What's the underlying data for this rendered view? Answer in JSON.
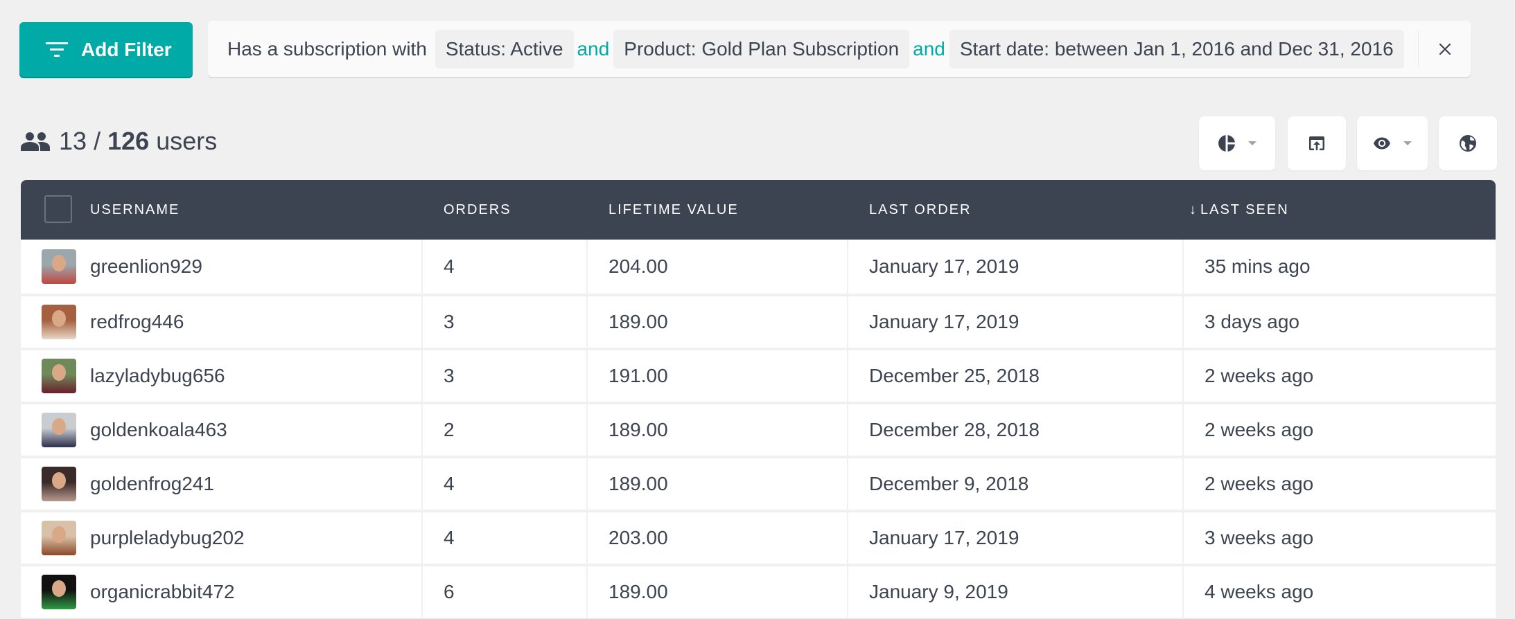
{
  "toolbar": {
    "add_filter_label": "Add Filter"
  },
  "filter": {
    "lead": "Has a subscription with",
    "conditions": [
      "Status: Active",
      "Product: Gold Plan Subscription",
      "Start date: between Jan 1, 2016 and Dec 31, 2016"
    ],
    "conjunction": "and"
  },
  "count": {
    "shown": "13",
    "separator": "/",
    "total": "126",
    "unit": "users"
  },
  "view_buttons": [
    {
      "icon": "pie-chart-icon",
      "has_dropdown": true
    },
    {
      "icon": "export-icon",
      "has_dropdown": false
    },
    {
      "icon": "eye-icon",
      "has_dropdown": true
    },
    {
      "icon": "globe-icon",
      "has_dropdown": false
    }
  ],
  "table": {
    "columns": [
      {
        "label": "USERNAME",
        "sort": ""
      },
      {
        "label": "ORDERS",
        "sort": ""
      },
      {
        "label": "LIFETIME VALUE",
        "sort": ""
      },
      {
        "label": "LAST ORDER",
        "sort": ""
      },
      {
        "label": "LAST SEEN",
        "sort": "↓"
      }
    ],
    "rows": [
      {
        "username": "greenlion929",
        "orders": "4",
        "lifetime_value": "204.00",
        "last_order": "January 17, 2019",
        "last_seen": "35 mins ago",
        "avatar_colors": [
          "#9aa7ad",
          "#c0473f"
        ]
      },
      {
        "username": "redfrog446",
        "orders": "3",
        "lifetime_value": "189.00",
        "last_order": "January 17, 2019",
        "last_seen": "3 days ago",
        "avatar_colors": [
          "#a5603f",
          "#e8d6c6"
        ]
      },
      {
        "username": "lazyladybug656",
        "orders": "3",
        "lifetime_value": "191.00",
        "last_order": "December 25, 2018",
        "last_seen": "2 weeks ago",
        "avatar_colors": [
          "#6f8a5a",
          "#6a1f2b"
        ]
      },
      {
        "username": "goldenkoala463",
        "orders": "2",
        "lifetime_value": "189.00",
        "last_order": "December 28, 2018",
        "last_seen": "2 weeks ago",
        "avatar_colors": [
          "#c9ccd1",
          "#2b2f4a"
        ]
      },
      {
        "username": "goldenfrog241",
        "orders": "4",
        "lifetime_value": "189.00",
        "last_order": "December 9, 2018",
        "last_seen": "2 weeks ago",
        "avatar_colors": [
          "#3a2a2a",
          "#b89a8e"
        ]
      },
      {
        "username": "purpleladybug202",
        "orders": "4",
        "lifetime_value": "203.00",
        "last_order": "January 17, 2019",
        "last_seen": "3 weeks ago",
        "avatar_colors": [
          "#d8c1a8",
          "#8a4a2a"
        ]
      },
      {
        "username": "organicrabbit472",
        "orders": "6",
        "lifetime_value": "189.00",
        "last_order": "January 9, 2019",
        "last_seen": "4 weeks ago",
        "avatar_colors": [
          "#111111",
          "#2f9a45"
        ]
      }
    ]
  }
}
